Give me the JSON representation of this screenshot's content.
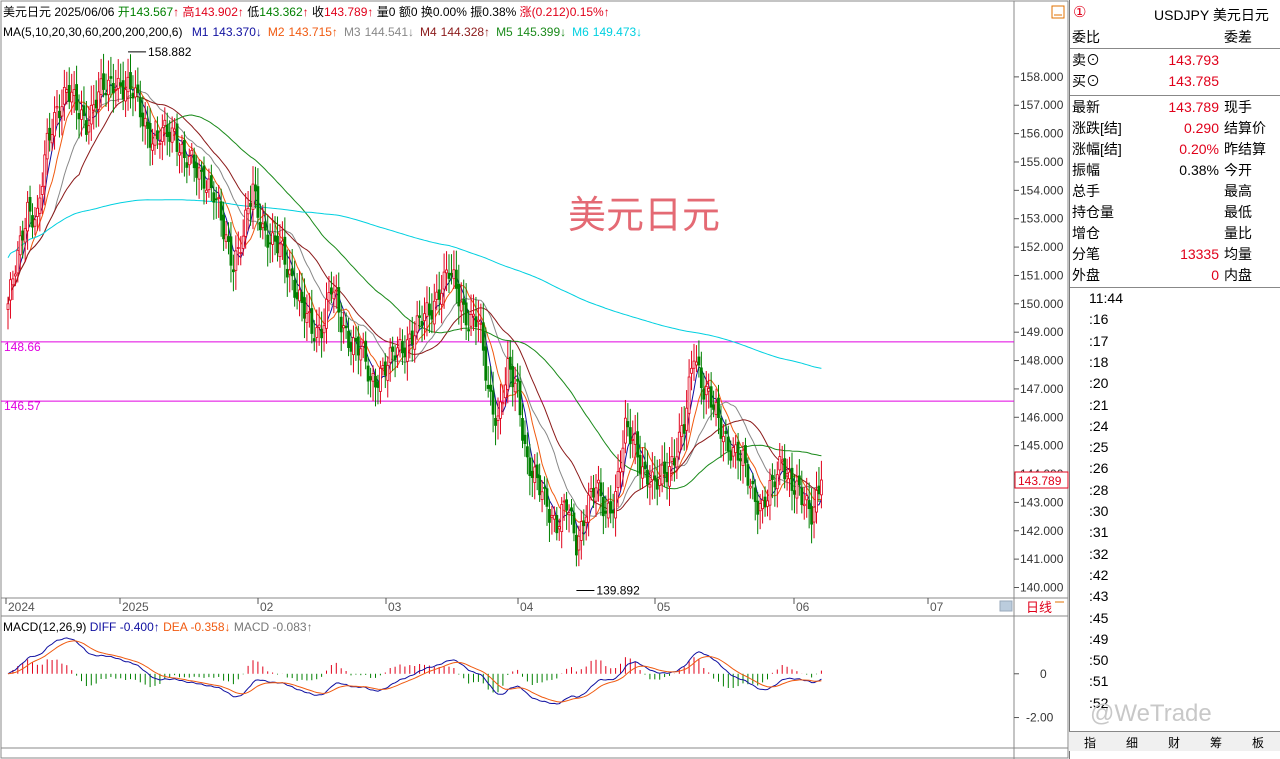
{
  "header": {
    "symbol_name": "美元日元",
    "date": "2025/06/06",
    "open_label": "开",
    "open": "143.567",
    "high_label": "高",
    "high": "143.902",
    "low_label": "低",
    "low": "143.362",
    "close_label": "收",
    "close": "143.789",
    "volume_label": "量",
    "volume": "0",
    "amount_label": "额",
    "amount": "0",
    "turnover_label": "换",
    "turnover": "0.00%",
    "amplitude_label": "振",
    "amplitude": "0.38%",
    "change_label": "涨",
    "change": "(0.212)",
    "change_pct": "0.15%",
    "arrow_up": "↑",
    "arrow_down": "↓"
  },
  "ma_legend": {
    "title": "MA(5,10,20,30,60,200,200,200,6)",
    "items": [
      {
        "name": "M1",
        "value": "143.370",
        "dir": "↓",
        "color": "#1010a0"
      },
      {
        "name": "M2",
        "value": "143.715",
        "dir": "↑",
        "color": "#f05a10"
      },
      {
        "name": "M3",
        "value": "144.541",
        "dir": "↓",
        "color": "#888888"
      },
      {
        "name": "M4",
        "value": "144.328",
        "dir": "↑",
        "color": "#8b1a1a"
      },
      {
        "name": "M5",
        "value": "145.399",
        "dir": "↓",
        "color": "#1a8a1a"
      },
      {
        "name": "M6",
        "value": "149.473",
        "dir": "↓",
        "color": "#00d0e0"
      }
    ]
  },
  "watermark": "美元日元",
  "hlines": [
    {
      "value": 148.66,
      "label": "148.66"
    },
    {
      "value": 146.57,
      "label": "146.57"
    }
  ],
  "peak_label": "158.882",
  "trough_label": "139.892",
  "current_price_label": "143.789",
  "period_label": "日线",
  "macd_legend": {
    "title": "MACD(12,26,9)",
    "diff_label": "DIFF",
    "diff": "-0.400",
    "diff_dir": "↑",
    "dea_label": "DEA",
    "dea": "-0.358",
    "dea_dir": "↓",
    "macd_label": "MACD",
    "macd": "-0.083",
    "macd_dir": "↑"
  },
  "macd_axis": [
    "0",
    "-2.00"
  ],
  "chart_data": {
    "type": "candlestick",
    "y_ticks": [
      "158.000",
      "157.000",
      "156.000",
      "155.000",
      "154.000",
      "153.000",
      "152.000",
      "151.000",
      "150.000",
      "149.000",
      "148.000",
      "147.000",
      "146.000",
      "145.000",
      "144.000",
      "143.000",
      "142.000",
      "141.000",
      "140.000"
    ],
    "x_labels": [
      "2024",
      "2025",
      "02",
      "03",
      "04",
      "05",
      "06",
      "07"
    ],
    "ylim": [
      139.7,
      159.3
    ],
    "anchors": [
      [
        0,
        150.0
      ],
      [
        4,
        151.5
      ],
      [
        8,
        153.5
      ],
      [
        12,
        153.0
      ],
      [
        16,
        155.5
      ],
      [
        20,
        157.0
      ],
      [
        24,
        157.5
      ],
      [
        28,
        156.8
      ],
      [
        32,
        156.5
      ],
      [
        36,
        157.2
      ],
      [
        40,
        157.5
      ],
      [
        44,
        158.0
      ],
      [
        48,
        157.5
      ],
      [
        52,
        157.3
      ],
      [
        56,
        156.5
      ],
      [
        60,
        155.5
      ],
      [
        64,
        156.0
      ],
      [
        68,
        156.2
      ],
      [
        72,
        155.0
      ],
      [
        76,
        154.8
      ],
      [
        80,
        154.6
      ],
      [
        84,
        153.8
      ],
      [
        88,
        152.5
      ],
      [
        92,
        151.6
      ],
      [
        96,
        152.3
      ],
      [
        100,
        154.0
      ],
      [
        104,
        152.8
      ],
      [
        108,
        152.0
      ],
      [
        112,
        151.8
      ],
      [
        116,
        151.0
      ],
      [
        120,
        149.8
      ],
      [
        124,
        149.0
      ],
      [
        128,
        149.3
      ],
      [
        132,
        150.5
      ],
      [
        136,
        149.3
      ],
      [
        140,
        148.8
      ],
      [
        144,
        148.3
      ],
      [
        148,
        147.2
      ],
      [
        152,
        147.7
      ],
      [
        156,
        147.9
      ],
      [
        160,
        148.4
      ],
      [
        164,
        148.9
      ],
      [
        168,
        149.2
      ],
      [
        172,
        149.7
      ],
      [
        176,
        150.6
      ],
      [
        180,
        151.0
      ],
      [
        184,
        150.3
      ],
      [
        188,
        149.5
      ],
      [
        192,
        149.3
      ],
      [
        196,
        147.0
      ],
      [
        200,
        146.0
      ],
      [
        204,
        147.5
      ],
      [
        208,
        147.0
      ],
      [
        212,
        144.5
      ],
      [
        216,
        143.5
      ],
      [
        220,
        143.0
      ],
      [
        224,
        142.3
      ],
      [
        228,
        142.8
      ],
      [
        232,
        141.6
      ],
      [
        236,
        142.9
      ],
      [
        240,
        143.4
      ],
      [
        244,
        142.7
      ],
      [
        248,
        143.3
      ],
      [
        252,
        145.4
      ],
      [
        256,
        145.2
      ],
      [
        260,
        144.0
      ],
      [
        264,
        143.4
      ],
      [
        268,
        144.2
      ],
      [
        272,
        144.6
      ],
      [
        276,
        145.5
      ],
      [
        280,
        148.5
      ],
      [
        284,
        147.0
      ],
      [
        288,
        146.2
      ],
      [
        292,
        145.5
      ],
      [
        296,
        144.8
      ],
      [
        300,
        144.3
      ],
      [
        304,
        143.5
      ],
      [
        308,
        142.8
      ],
      [
        312,
        143.4
      ],
      [
        316,
        144.7
      ],
      [
        320,
        143.6
      ],
      [
        324,
        143.0
      ],
      [
        328,
        142.8
      ],
      [
        332,
        143.789
      ]
    ],
    "current": 143.789,
    "macd_ylim": [
      -3.3,
      2.0
    ]
  },
  "right_panel": {
    "badge": "①",
    "title": "USDJPY 美元日元",
    "rows": [
      {
        "l": "委比",
        "v": "",
        "r": "委差"
      },
      {
        "l": "卖",
        "l2": "⊙",
        "v": "143.793",
        "r": ""
      },
      {
        "l": "买",
        "l2": "⊙",
        "v": "143.785",
        "r": ""
      },
      {
        "l": "最新",
        "v": "143.789",
        "r": "现手"
      },
      {
        "l": "涨跌[结]",
        "v": "0.290",
        "r": "结算价"
      },
      {
        "l": "涨幅[结]",
        "v": "0.20%",
        "r": "昨结算"
      },
      {
        "l": "振幅",
        "v": "0.38%",
        "r": "今开"
      },
      {
        "l": "总手",
        "v": "",
        "r": "最高"
      },
      {
        "l": "持仓量",
        "v": "",
        "r": "最低"
      },
      {
        "l": "增仓",
        "v": "",
        "r": "量比"
      },
      {
        "l": "分笔",
        "v": "13335",
        "r": "均量"
      },
      {
        "l": "外盘",
        "v": "0",
        "r": "内盘"
      }
    ],
    "times": [
      "11:44",
      ":16",
      ":17",
      ":18",
      ":20",
      ":21",
      ":24",
      ":25",
      ":26",
      ":28",
      ":30",
      ":31",
      ":32",
      ":42",
      ":43",
      ":45",
      ":49",
      ":50",
      ":51",
      ":52"
    ],
    "tabs": [
      "指",
      "细",
      "财",
      "筹",
      "板"
    ],
    "watermark": "@WeTrade"
  }
}
